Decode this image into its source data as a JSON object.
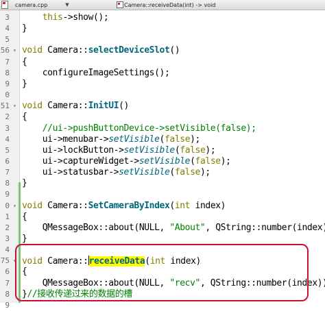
{
  "toolbar": {
    "file_name": "camera.cpp",
    "file_dropdown_glyph": "▼",
    "function_signature": "Camera::receiveData(int) -> void"
  },
  "lines": [
    {
      "num": "3",
      "fold": "",
      "tokens": [
        {
          "t": "    "
        },
        {
          "t": "this",
          "c": "kw"
        },
        {
          "t": "->show();"
        }
      ]
    },
    {
      "num": "4",
      "fold": "",
      "tokens": [
        {
          "t": "}"
        }
      ]
    },
    {
      "num": "5",
      "fold": "",
      "tokens": []
    },
    {
      "num": "56",
      "fold": "▾",
      "tokens": [
        {
          "t": "void",
          "c": "kw"
        },
        {
          "t": " Camera::"
        },
        {
          "t": "selectDeviceSlot",
          "c": "fn"
        },
        {
          "t": "()"
        }
      ]
    },
    {
      "num": "7",
      "fold": "",
      "tokens": [
        {
          "t": "{"
        }
      ]
    },
    {
      "num": "8",
      "fold": "",
      "tokens": [
        {
          "t": "    configureImageSettings();"
        }
      ]
    },
    {
      "num": "9",
      "fold": "",
      "tokens": [
        {
          "t": "}"
        }
      ]
    },
    {
      "num": "0",
      "fold": "",
      "tokens": []
    },
    {
      "num": "51",
      "fold": "▾",
      "tokens": [
        {
          "t": "void",
          "c": "kw"
        },
        {
          "t": " Camera::"
        },
        {
          "t": "InitUI",
          "c": "fn"
        },
        {
          "t": "()"
        }
      ]
    },
    {
      "num": "2",
      "fold": "",
      "tokens": [
        {
          "t": "{"
        }
      ]
    },
    {
      "num": "3",
      "fold": "",
      "tokens": [
        {
          "t": "    "
        },
        {
          "t": "//ui->pushButtonDevice->setVisible(false);",
          "c": "cm"
        }
      ]
    },
    {
      "num": "4",
      "fold": "",
      "tokens": [
        {
          "t": "    ui->menubar->"
        },
        {
          "t": "setVisible",
          "c": "it"
        },
        {
          "t": "("
        },
        {
          "t": "false",
          "c": "kw"
        },
        {
          "t": ");"
        }
      ]
    },
    {
      "num": "5",
      "fold": "",
      "tokens": [
        {
          "t": "    ui->lockButton->"
        },
        {
          "t": "setVisible",
          "c": "it"
        },
        {
          "t": "("
        },
        {
          "t": "false",
          "c": "kw"
        },
        {
          "t": ");"
        }
      ]
    },
    {
      "num": "6",
      "fold": "",
      "tokens": [
        {
          "t": "    ui->captureWidget->"
        },
        {
          "t": "setVisible",
          "c": "it"
        },
        {
          "t": "("
        },
        {
          "t": "false",
          "c": "kw"
        },
        {
          "t": ");"
        }
      ]
    },
    {
      "num": "7",
      "fold": "",
      "tokens": [
        {
          "t": "    ui->statusbar->"
        },
        {
          "t": "setVisible",
          "c": "it"
        },
        {
          "t": "("
        },
        {
          "t": "false",
          "c": "kw"
        },
        {
          "t": ");"
        }
      ]
    },
    {
      "num": "8",
      "fold": "",
      "tokens": [
        {
          "t": "}"
        }
      ]
    },
    {
      "num": "9",
      "fold": "",
      "tokens": []
    },
    {
      "num": "0",
      "fold": "▾",
      "tokens": [
        {
          "t": "void",
          "c": "kw"
        },
        {
          "t": " Camera::"
        },
        {
          "t": "SetCameraByIndex",
          "c": "fn"
        },
        {
          "t": "("
        },
        {
          "t": "int",
          "c": "kw"
        },
        {
          "t": " index)"
        }
      ]
    },
    {
      "num": "1",
      "fold": "",
      "tokens": [
        {
          "t": "{"
        }
      ]
    },
    {
      "num": "2",
      "fold": "",
      "tokens": [
        {
          "t": "    QMessageBox::about(NULL, "
        },
        {
          "t": "\"About\"",
          "c": "str"
        },
        {
          "t": ", QString::number(index));"
        }
      ]
    },
    {
      "num": "3",
      "fold": "",
      "tokens": [
        {
          "t": "}"
        }
      ]
    },
    {
      "num": "4",
      "fold": "",
      "tokens": []
    },
    {
      "num": "75",
      "fold": "▾",
      "tokens": [
        {
          "t": "void",
          "c": "kw"
        },
        {
          "t": " Camera::"
        },
        {
          "t": "",
          "cursor": true
        },
        {
          "t": "receiveData",
          "c": "fn hl"
        },
        {
          "t": "("
        },
        {
          "t": "int",
          "c": "kw"
        },
        {
          "t": " index)"
        }
      ]
    },
    {
      "num": "6",
      "fold": "",
      "tokens": [
        {
          "t": "{"
        }
      ]
    },
    {
      "num": "7",
      "fold": "",
      "tokens": [
        {
          "t": "    QMessageBox::about(NULL, "
        },
        {
          "t": "\"recv\"",
          "c": "str"
        },
        {
          "t": ", QString::number(index));"
        }
      ]
    },
    {
      "num": "8",
      "fold": "",
      "tokens": [
        {
          "t": "}"
        },
        {
          "t": "//接收传递过来的数据的槽",
          "c": "cm"
        }
      ]
    },
    {
      "num": "9",
      "fold": "",
      "tokens": []
    }
  ]
}
